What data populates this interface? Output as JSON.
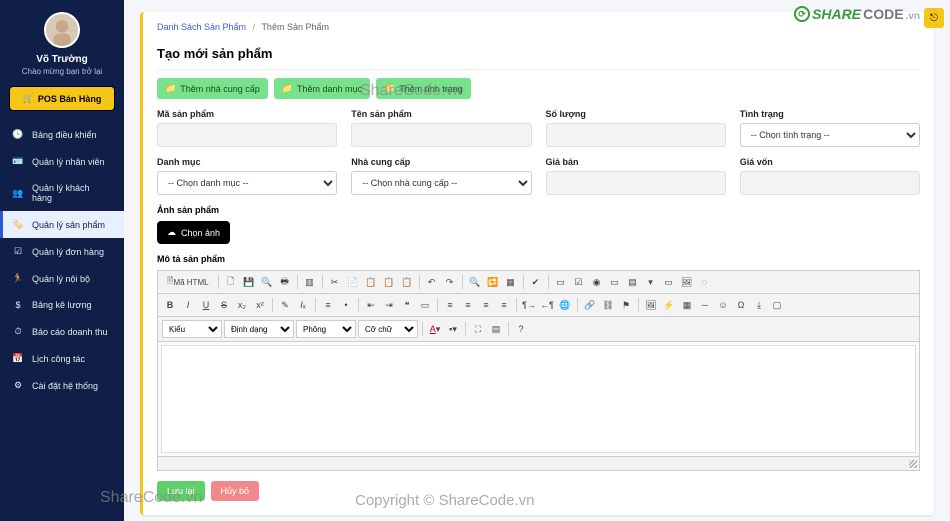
{
  "user": {
    "name": "Võ Trường",
    "welcome": "Chào mừng bạn trở lại"
  },
  "pos_label": "POS Bán Hàng",
  "sidebar": {
    "items": [
      {
        "label": "Bảng điều khiển"
      },
      {
        "label": "Quản lý nhân viên"
      },
      {
        "label": "Quản lý khách hàng"
      },
      {
        "label": "Quản lý sản phẩm"
      },
      {
        "label": "Quản lý đơn hàng"
      },
      {
        "label": "Quản lý nội bộ"
      },
      {
        "label": "Bảng kê lương"
      },
      {
        "label": "Báo cáo doanh thu"
      },
      {
        "label": "Lịch công tác"
      },
      {
        "label": "Cài đặt hệ thống"
      }
    ],
    "active_index": 3
  },
  "breadcrumb": {
    "parent": "Danh Sách Sản Phẩm",
    "current": "Thêm Sản Phẩm"
  },
  "page_title": "Tạo mới sản phẩm",
  "quick_add": {
    "supplier": "Thêm nhà cung cấp",
    "category": "Thêm danh mục",
    "status": "Thêm tình trạng"
  },
  "form": {
    "code_label": "Mã sản phẩm",
    "name_label": "Tên sản phẩm",
    "qty_label": "Số lượng",
    "status_label": "Tình trạng",
    "status_placeholder": "-- Chọn tình trạng --",
    "category_label": "Danh mục",
    "category_placeholder": "-- Chọn danh mục --",
    "supplier_label": "Nhà cung cấp",
    "supplier_placeholder": "-- Chọn nhà cung cấp --",
    "price_label": "Giá bán",
    "cost_label": "Giá vốn",
    "image_label": "Ảnh sản phẩm",
    "choose_image": "Chọn ảnh",
    "desc_label": "Mô tả sản phẩm"
  },
  "editor": {
    "source_btn": "Mã HTML",
    "style_select": "Kiểu",
    "format_select": "Định dạng",
    "font_select": "Phông",
    "size_select": "Cỡ chữ"
  },
  "actions": {
    "save": "Lưu lại",
    "cancel": "Hủy bỏ"
  },
  "watermarks": {
    "top_center": "ShareCode.vn",
    "bottom_left": "ShareCode.vn",
    "bottom_center": "Copyright © ShareCode.vn",
    "logo_share": "SHARE",
    "logo_code": "CODE",
    "logo_vn": ".vn"
  }
}
